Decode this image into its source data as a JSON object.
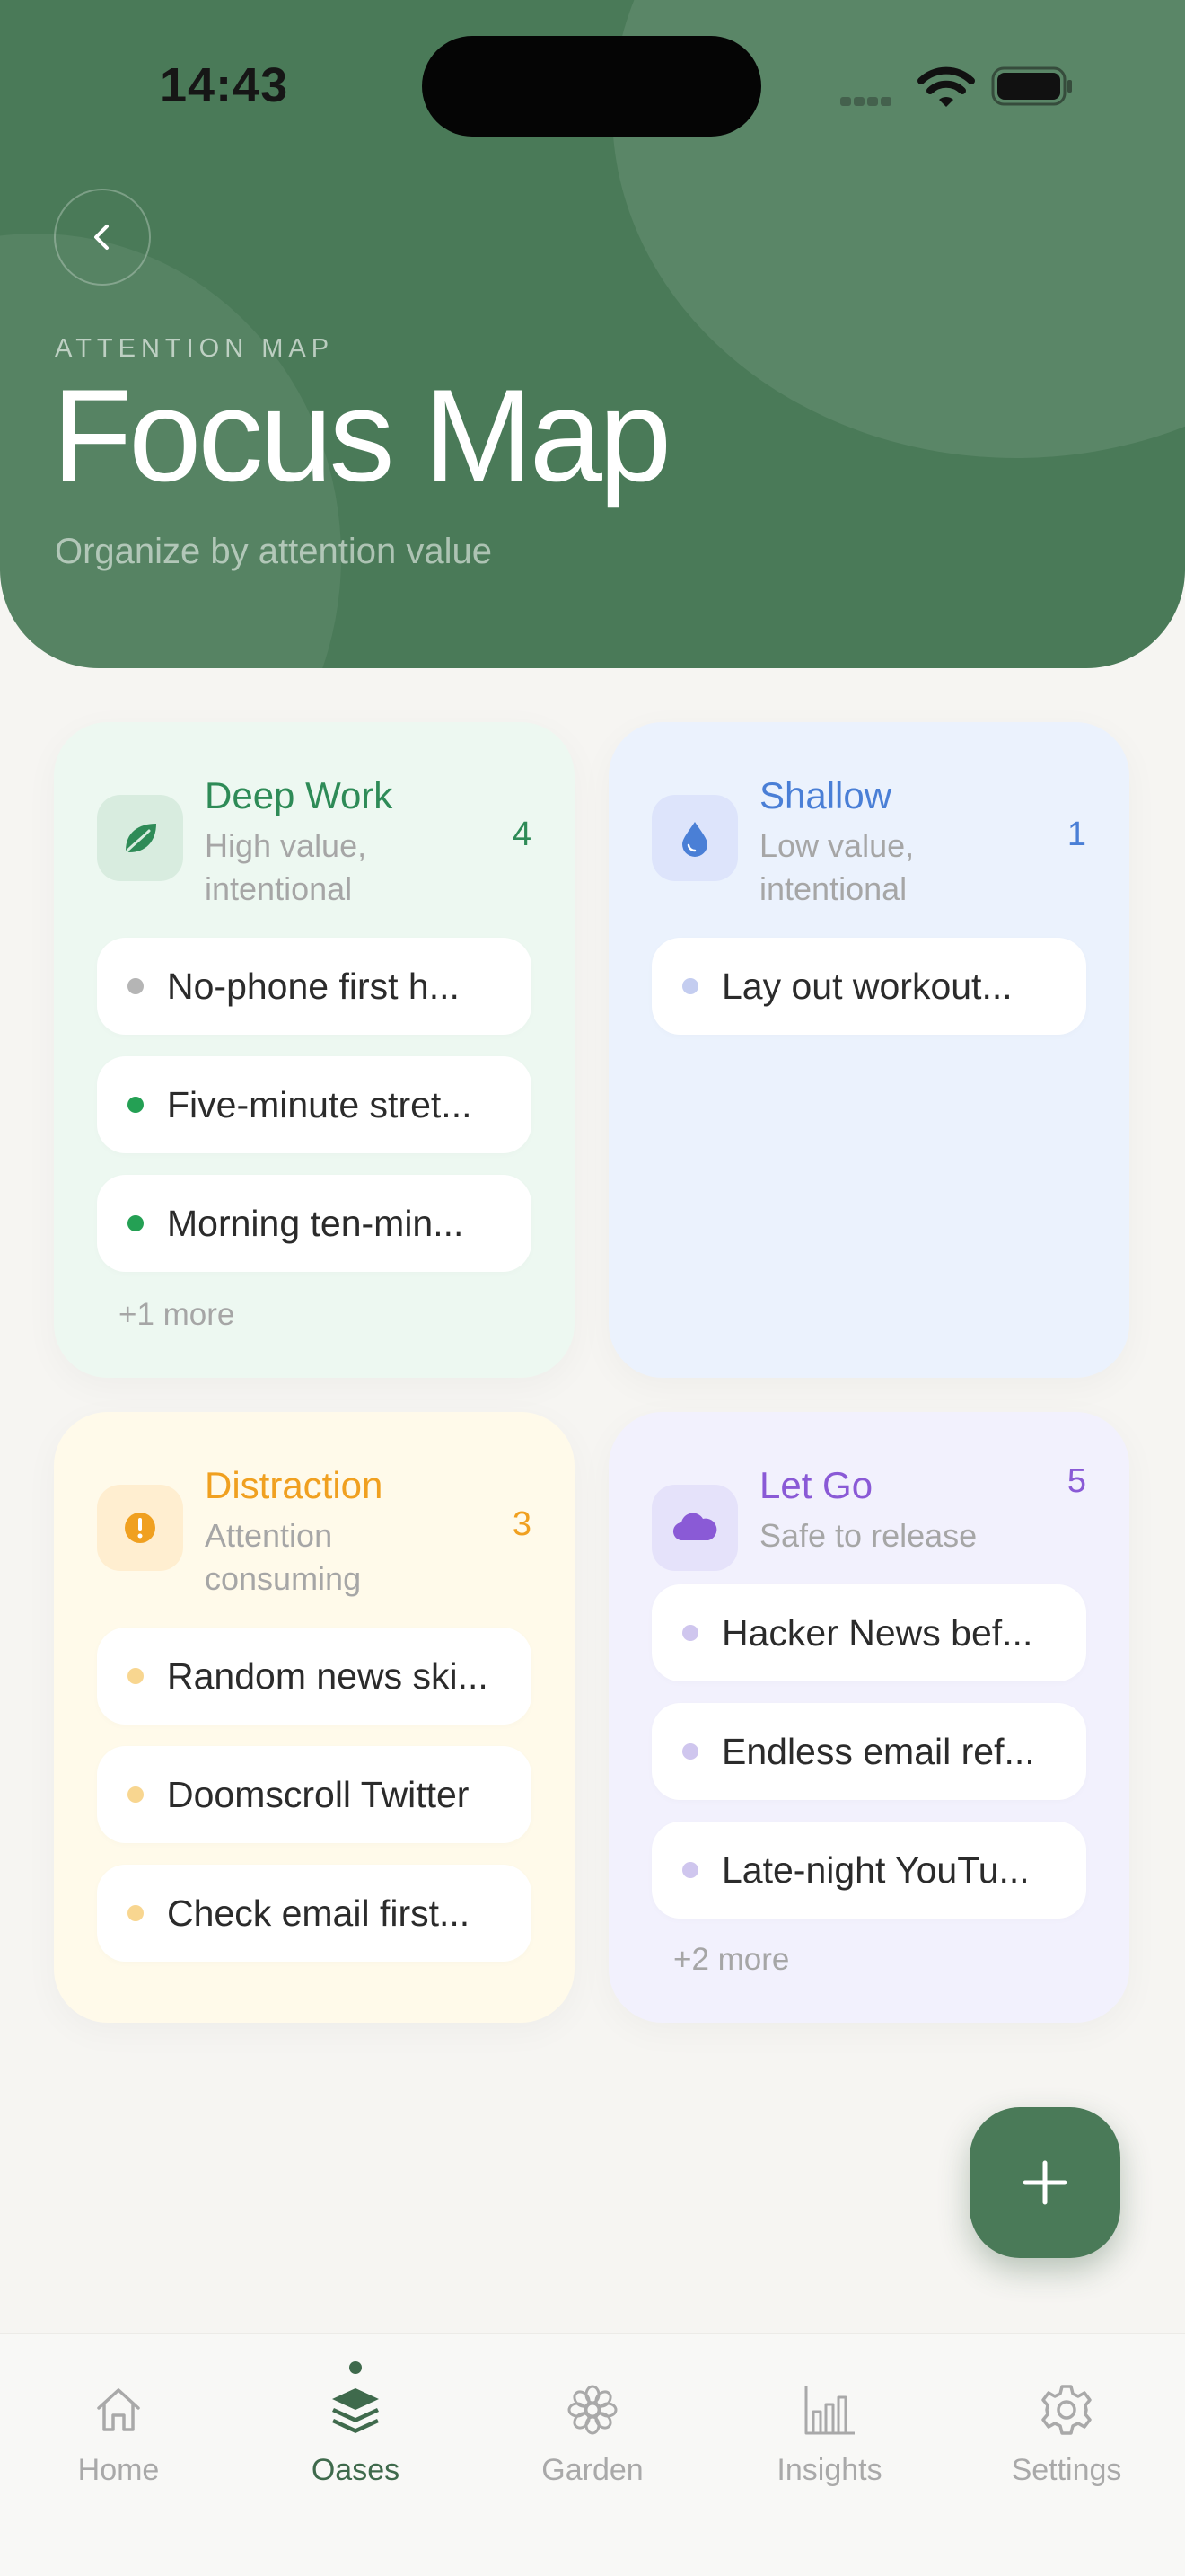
{
  "status_bar": {
    "time": "14:43"
  },
  "header": {
    "eyebrow": "ATTENTION MAP",
    "title": "Focus Map",
    "subtitle": "Organize by attention value"
  },
  "quadrants": [
    {
      "title": "Deep Work",
      "description": "High value, intentional",
      "count": "4",
      "icon": "leaf-icon",
      "accent": "#2e8b57",
      "items": [
        "No-phone first h...",
        "Five-minute stret...",
        "Morning ten-min..."
      ],
      "dot_colors": [
        "#b5b5b5",
        "#24a054",
        "#24a054"
      ],
      "more": "+1 more"
    },
    {
      "title": "Shallow",
      "description": "Low value, intentional",
      "count": "1",
      "icon": "water-drop-icon",
      "accent": "#4a7fd6",
      "items": [
        "Lay out workout..."
      ],
      "dot_colors": [
        "#c4cdf0"
      ],
      "more": ""
    },
    {
      "title": "Distraction",
      "description": "Attention consuming",
      "count": "3",
      "icon": "alert-icon",
      "accent": "#f0a020",
      "items": [
        "Random news ski...",
        "Doomscroll Twitter",
        "Check email first..."
      ],
      "dot_colors": [
        "#f8d690",
        "#f8d690",
        "#f8d690"
      ],
      "more": ""
    },
    {
      "title": "Let Go",
      "description": "Safe to release",
      "count": "5",
      "icon": "cloud-icon",
      "accent": "#8a5ad6",
      "items": [
        "Hacker News bef...",
        "Endless email ref...",
        "Late-night YouTu..."
      ],
      "dot_colors": [
        "#cfc6ee",
        "#cfc6ee",
        "#cfc6ee"
      ],
      "more": "+2 more"
    }
  ],
  "tabs": [
    {
      "label": "Home",
      "icon": "home-icon",
      "active": false
    },
    {
      "label": "Oases",
      "icon": "layers-icon",
      "active": true
    },
    {
      "label": "Garden",
      "icon": "flower-icon",
      "active": false
    },
    {
      "label": "Insights",
      "icon": "bar-chart-icon",
      "active": false
    },
    {
      "label": "Settings",
      "icon": "gear-icon",
      "active": false
    }
  ],
  "colors": {
    "brand_green": "#4a7a58",
    "deep_work_bg": "#edf8f1",
    "shallow_bg": "#ebf2fd",
    "distraction_bg": "#fffaea",
    "let_go_bg": "#f2f1fd"
  }
}
